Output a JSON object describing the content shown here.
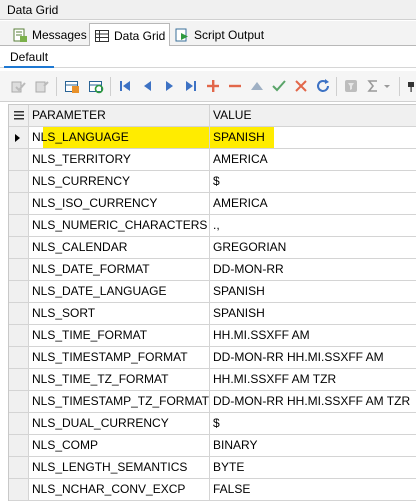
{
  "window": {
    "title": "Data Grid"
  },
  "tabs": [
    {
      "label": "Messages",
      "icon": "messages-icon"
    },
    {
      "label": "Data Grid",
      "icon": "grid-icon"
    },
    {
      "label": "Script Output",
      "icon": "script-output-icon"
    }
  ],
  "subtab": {
    "label": "Default"
  },
  "toolbar": {
    "icons": [
      "commit-icon",
      "rollback-icon",
      "export-icon",
      "refresh-data-icon",
      "first-record-icon",
      "prev-record-icon",
      "next-record-icon",
      "last-record-icon",
      "insert-record-icon",
      "delete-record-icon",
      "edit-record-icon",
      "post-edit-icon",
      "cancel-edit-icon",
      "refresh-icon",
      "filter-icon",
      "sum-icon",
      "dropdown-icon",
      "pin-icon"
    ]
  },
  "grid": {
    "headers": {
      "param": "PARAMETER",
      "value": "VALUE"
    },
    "rows": [
      {
        "param": "NLS_LANGUAGE",
        "value": "SPANISH",
        "selected": true
      },
      {
        "param": "NLS_TERRITORY",
        "value": "AMERICA"
      },
      {
        "param": "NLS_CURRENCY",
        "value": "$"
      },
      {
        "param": "NLS_ISO_CURRENCY",
        "value": "AMERICA"
      },
      {
        "param": "NLS_NUMERIC_CHARACTERS",
        "value": ".,"
      },
      {
        "param": "NLS_CALENDAR",
        "value": "GREGORIAN"
      },
      {
        "param": "NLS_DATE_FORMAT",
        "value": "DD-MON-RR"
      },
      {
        "param": "NLS_DATE_LANGUAGE",
        "value": "SPANISH"
      },
      {
        "param": "NLS_SORT",
        "value": "SPANISH"
      },
      {
        "param": "NLS_TIME_FORMAT",
        "value": "HH.MI.SSXFF AM"
      },
      {
        "param": "NLS_TIMESTAMP_FORMAT",
        "value": "DD-MON-RR HH.MI.SSXFF AM"
      },
      {
        "param": "NLS_TIME_TZ_FORMAT",
        "value": "HH.MI.SSXFF AM TZR"
      },
      {
        "param": "NLS_TIMESTAMP_TZ_FORMAT",
        "value": "DD-MON-RR HH.MI.SSXFF AM TZR"
      },
      {
        "param": "NLS_DUAL_CURRENCY",
        "value": "$"
      },
      {
        "param": "NLS_COMP",
        "value": "BINARY"
      },
      {
        "param": "NLS_LENGTH_SEMANTICS",
        "value": "BYTE"
      },
      {
        "param": "NLS_NCHAR_CONV_EXCP",
        "value": "FALSE"
      }
    ]
  },
  "colors": {
    "highlight": "#ffec00",
    "accent": "#1e78d2"
  }
}
